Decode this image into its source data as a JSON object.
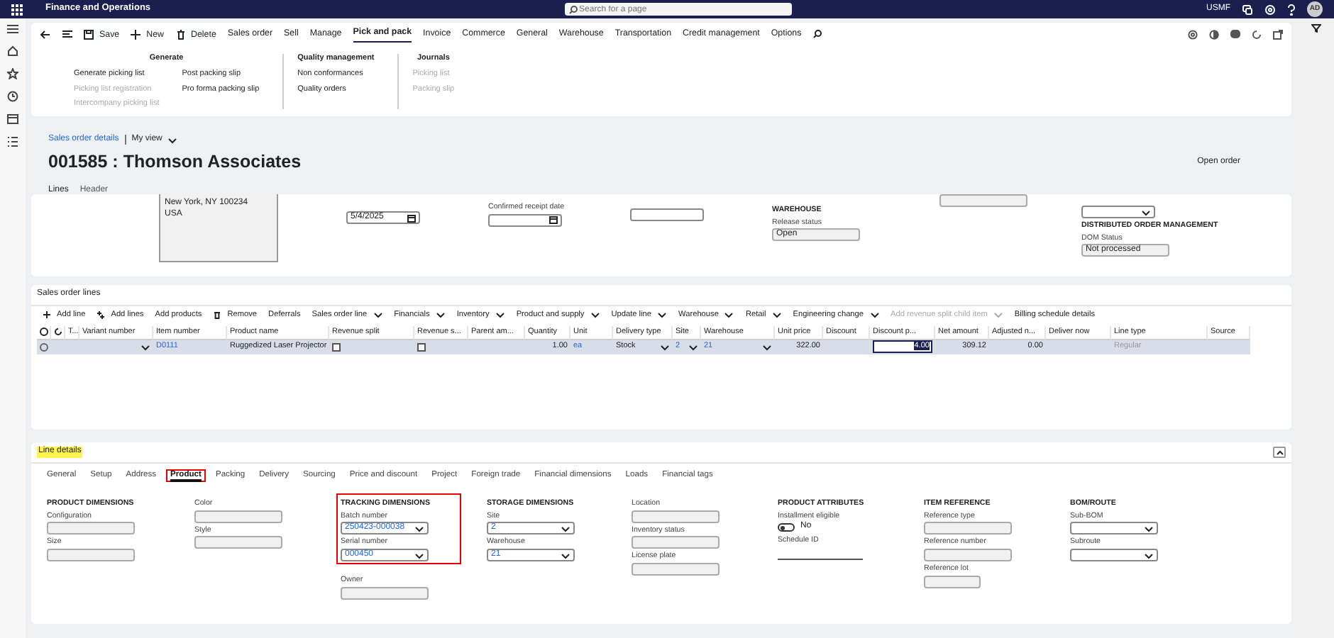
{
  "app_bar": {
    "title": "Finance and Operations",
    "search_placeholder": "Search for a page",
    "company": "USMF",
    "avatar": "AD"
  },
  "action_pane": {
    "commands": [
      {
        "label": "Save",
        "kind": "save"
      },
      {
        "label": "New",
        "kind": "new"
      },
      {
        "label": "Delete",
        "kind": "delete"
      }
    ],
    "tabs": [
      {
        "label": "Sales order",
        "selected": false
      },
      {
        "label": "Sell",
        "selected": false
      },
      {
        "label": "Manage",
        "selected": false
      },
      {
        "label": "Pick and pack",
        "selected": true
      },
      {
        "label": "Invoice",
        "selected": false
      },
      {
        "label": "Commerce",
        "selected": false
      },
      {
        "label": "General",
        "selected": false
      },
      {
        "label": "Warehouse",
        "selected": false
      },
      {
        "label": "Transportation",
        "selected": false
      },
      {
        "label": "Credit management",
        "selected": false
      },
      {
        "label": "Options",
        "selected": false
      }
    ],
    "groups": [
      {
        "title": "Generate",
        "columns": [
          [
            {
              "label": "Generate picking list",
              "disabled": false
            },
            {
              "label": "Picking list registration",
              "disabled": true
            },
            {
              "label": "Intercompany picking list",
              "disabled": true
            }
          ],
          [
            {
              "label": "Post packing slip",
              "disabled": false
            },
            {
              "label": "Pro forma packing slip",
              "disabled": false
            }
          ]
        ]
      },
      {
        "title": "Quality management",
        "columns": [
          [
            {
              "label": "Non conformances",
              "disabled": false
            },
            {
              "label": "Quality orders",
              "disabled": false
            }
          ]
        ]
      },
      {
        "title": "Journals",
        "columns": [
          [
            {
              "label": "Picking list",
              "disabled": true
            },
            {
              "label": "Packing slip",
              "disabled": true
            }
          ]
        ]
      }
    ]
  },
  "page": {
    "breadcrumb": "Sales order details",
    "view": "My view",
    "title": "001585 : Thomson Associates",
    "status": "Open order",
    "tabs": [
      {
        "label": "Lines",
        "selected": true
      },
      {
        "label": "Header",
        "selected": false
      }
    ]
  },
  "header_fields": [
    {
      "items": [
        {
          "kind": "address",
          "lines": [
            "New York, NY 100234",
            "USA"
          ]
        }
      ]
    },
    {
      "items": [
        {
          "kind": "date",
          "value": "5/4/2025"
        }
      ]
    },
    {
      "items": [
        {
          "kind": "date",
          "label": "Confirmed receipt date"
        }
      ]
    },
    {
      "items": [
        {
          "kind": "input"
        }
      ]
    },
    {
      "items": [
        {
          "kind": "heading",
          "label": "WAREHOUSE"
        },
        {
          "kind": "readonly",
          "label": "Release status",
          "value": "Open"
        }
      ]
    },
    {
      "items": [
        {
          "kind": "readonly"
        }
      ]
    },
    {
      "items": [
        {
          "kind": "dropdown"
        },
        {
          "kind": "heading",
          "label": "DISTRIBUTED ORDER MANAGEMENT"
        },
        {
          "kind": "readonly",
          "label": "DOM Status",
          "value": "Not processed"
        }
      ]
    }
  ],
  "sales_order_lines": {
    "title": "Sales order lines",
    "toolbar": [
      {
        "label": "Add line",
        "kind": "add",
        "dropdown": false,
        "disabled": false
      },
      {
        "label": "Add lines",
        "kind": "addmany",
        "dropdown": false,
        "disabled": false
      },
      {
        "label": "Add products",
        "kind": "plain",
        "dropdown": false,
        "disabled": false
      },
      {
        "label": "Remove",
        "kind": "delete",
        "dropdown": false,
        "disabled": false
      },
      {
        "label": "Deferrals",
        "kind": "plain",
        "dropdown": false,
        "disabled": false
      },
      {
        "label": "Sales order line",
        "kind": "plain",
        "dropdown": true,
        "disabled": false
      },
      {
        "label": "Financials",
        "kind": "plain",
        "dropdown": true,
        "disabled": false
      },
      {
        "label": "Inventory",
        "kind": "plain",
        "dropdown": true,
        "disabled": false
      },
      {
        "label": "Product and supply",
        "kind": "plain",
        "dropdown": true,
        "disabled": false
      },
      {
        "label": "Update line",
        "kind": "plain",
        "dropdown": true,
        "disabled": false
      },
      {
        "label": "Warehouse",
        "kind": "plain",
        "dropdown": true,
        "disabled": false
      },
      {
        "label": "Retail",
        "kind": "plain",
        "dropdown": true,
        "disabled": false
      },
      {
        "label": "Engineering change",
        "kind": "plain",
        "dropdown": true,
        "disabled": false
      },
      {
        "label": "Add revenue split child item",
        "kind": "plain",
        "dropdown": true,
        "disabled": true
      },
      {
        "label": "Billing schedule details",
        "kind": "plain",
        "dropdown": false,
        "disabled": false
      }
    ],
    "columns": [
      "T...",
      "Variant number",
      "Item number",
      "Product name",
      "Revenue split",
      "Revenue s...",
      "Parent am...",
      "Quantity",
      "Unit",
      "Delivery type",
      "Site",
      "Warehouse",
      "Unit price",
      "Discount",
      "Discount p...",
      "Net amount",
      "Adjusted n...",
      "Deliver now",
      "Line type",
      "Source"
    ],
    "rows": [
      {
        "selected": true,
        "cells": [
          {
            "kind": "text"
          },
          {
            "kind": "dropdown"
          },
          {
            "kind": "link",
            "text": "D0111"
          },
          {
            "kind": "text",
            "text": "Ruggedized Laser Projector"
          },
          {
            "kind": "checkbox",
            "checked": false
          },
          {
            "kind": "checkbox",
            "checked": false
          },
          {
            "kind": "text"
          },
          {
            "kind": "number",
            "text": "1.00"
          },
          {
            "kind": "link",
            "text": "ea"
          },
          {
            "kind": "dropdown",
            "text": "Stock"
          },
          {
            "kind": "linkdrop",
            "text": "2"
          },
          {
            "kind": "linkdrop",
            "text": "21"
          },
          {
            "kind": "number",
            "text": "322.00"
          },
          {
            "kind": "text"
          },
          {
            "kind": "input",
            "text": "4.00"
          },
          {
            "kind": "number",
            "text": "309.12"
          },
          {
            "kind": "number",
            "text": "0.00"
          },
          {
            "kind": "text"
          },
          {
            "kind": "muted",
            "text": "Regular"
          },
          {
            "kind": "text"
          }
        ]
      }
    ]
  },
  "line_details": {
    "title": {
      "text": "Line details",
      "highlighted": true
    },
    "tabs": [
      {
        "label": "General",
        "selected": false
      },
      {
        "label": "Setup",
        "selected": false
      },
      {
        "label": "Address",
        "selected": false
      },
      {
        "label": "Product",
        "selected": true,
        "highlighted": true
      },
      {
        "label": "Packing",
        "selected": false
      },
      {
        "label": "Delivery",
        "selected": false
      },
      {
        "label": "Sourcing",
        "selected": false
      },
      {
        "label": "Price and discount",
        "selected": false
      },
      {
        "label": "Project",
        "selected": false
      },
      {
        "label": "Foreign trade",
        "selected": false
      },
      {
        "label": "Financial dimensions",
        "selected": false
      },
      {
        "label": "Loads",
        "selected": false
      },
      {
        "label": "Financial tags",
        "selected": false
      }
    ],
    "columns": [
      [
        {
          "heading": "PRODUCT DIMENSIONS",
          "fields": [
            {
              "label": "Configuration",
              "kind": "readonly"
            },
            {
              "label": "Size",
              "kind": "readonly"
            }
          ]
        }
      ],
      [
        {
          "fields": [
            {
              "label": "Color",
              "kind": "readonly"
            },
            {
              "label": "Style",
              "kind": "readonly"
            }
          ]
        }
      ],
      [
        {
          "heading": "TRACKING DIMENSIONS",
          "highlighted": true,
          "fields": [
            {
              "label": "Batch number",
              "kind": "dropdown",
              "value": "250423-000038"
            },
            {
              "label": "Serial number",
              "kind": "dropdown",
              "value": "000450"
            }
          ]
        },
        {
          "fields": [
            {
              "label": "Owner",
              "kind": "readonly"
            }
          ]
        }
      ],
      [
        {
          "heading": "STORAGE DIMENSIONS",
          "fields": [
            {
              "label": "Site",
              "kind": "dropdown",
              "value": "2"
            },
            {
              "label": "Warehouse",
              "kind": "dropdown",
              "value": "21"
            }
          ]
        }
      ],
      [
        {
          "fields": [
            {
              "label": "Location",
              "kind": "readonly"
            },
            {
              "label": "Inventory status",
              "kind": "readonly"
            },
            {
              "label": "License plate",
              "kind": "readonly"
            }
          ]
        }
      ],
      [
        {
          "heading": "PRODUCT ATTRIBUTES",
          "fields": [
            {
              "label": "Installment eligible",
              "kind": "toggle",
              "on": false,
              "value": "No"
            },
            {
              "label": "Schedule ID",
              "kind": "underline"
            }
          ]
        }
      ],
      [
        {
          "heading": "ITEM REFERENCE",
          "fields": [
            {
              "label": "Reference type",
              "kind": "readonly"
            },
            {
              "label": "Reference number",
              "kind": "readonly"
            },
            {
              "label": "Reference lot",
              "kind": "short"
            }
          ]
        }
      ],
      [
        {
          "heading": "BOM/ROUTE",
          "fields": [
            {
              "label": "Sub-BOM",
              "kind": "dropdown"
            },
            {
              "label": "Subroute",
              "kind": "dropdown"
            }
          ]
        }
      ]
    ]
  }
}
